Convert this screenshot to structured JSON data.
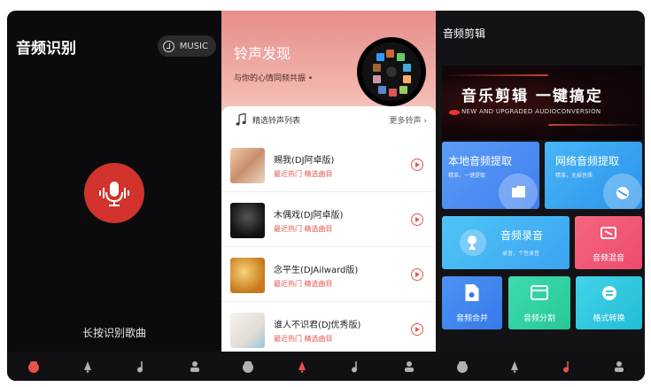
{
  "panels": {
    "recognition": {
      "title": "音频识别",
      "music_button": "MUSIC",
      "hint": "长按识别歌曲"
    },
    "ringtone": {
      "hero_title": "铃声发现",
      "hero_subtitle": "与你的心情同频共振",
      "section_title": "精选铃声列表",
      "more_label": "更多铃声",
      "songs": [
        {
          "title": "赐我(DJ阿卓版)",
          "tag": "最近热门 精选曲目"
        },
        {
          "title": "木偶戏(DJ阿卓版)",
          "tag": "最近热门 精选曲目"
        },
        {
          "title": "念平生(DJAilward版)",
          "tag": "最近热门 精选曲目"
        },
        {
          "title": "谁人不识君(DJ优秀版)",
          "tag": "最近热门 精选曲目"
        }
      ]
    },
    "editor": {
      "title": "音频剪辑",
      "banner_title": "音乐剪辑 一键搞定",
      "banner_subtitle": "NEW AND UPGRADED AUDIOCONVERSION",
      "cards": {
        "local": {
          "title": "本地音频提取",
          "sub": "精准，一键提取"
        },
        "network": {
          "title": "网络音频提取",
          "sub": "精准，无损音质"
        },
        "record": {
          "title": "音频录音",
          "sub": "录音，个性录音"
        },
        "mix": {
          "label": "音频混音"
        },
        "merge": {
          "label": "音频合并"
        },
        "split": {
          "label": "音频分割"
        },
        "convert": {
          "label": "格式转换"
        }
      }
    }
  },
  "colors": {
    "accent_red": "#d2332c",
    "card_blue": "#4a8ef0",
    "card_cyan": "#37c9e3",
    "card_green": "#35d6a5",
    "card_pink": "#f05a7a"
  }
}
